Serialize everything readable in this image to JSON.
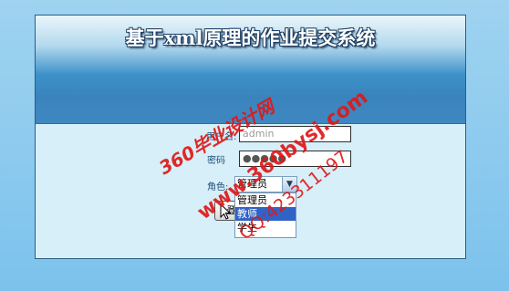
{
  "page": {
    "title": "基于xml原理的作业提交系统"
  },
  "form": {
    "username_label": "用户名:",
    "username_value": "admin",
    "password_label": "密码",
    "password_value": "●●●●●",
    "role_label": "角色:",
    "role_selected": "管理员",
    "role_options": [
      "管理员",
      "教师",
      "学生"
    ],
    "submit_label": "登"
  },
  "watermark": {
    "line1": "360毕业设计网",
    "line2": "www.360bysj.com",
    "line3": "QQ:423311197"
  },
  "colors": {
    "accent": "#3163c6",
    "watermark": "#e01818",
    "banner": "#3a84bd"
  }
}
